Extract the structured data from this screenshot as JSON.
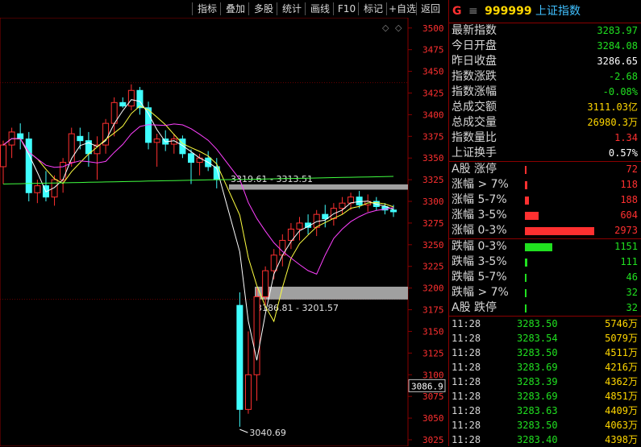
{
  "toolbar": {
    "items": [
      "指标",
      "叠加",
      "多股",
      "统计",
      "画线",
      "F10",
      "标记",
      "+自选",
      "返回"
    ]
  },
  "chart": {
    "price_label": "3086.9",
    "annotations": {
      "upper_zone": "3319.61 - 3313.51",
      "lower_zone": "3186.81 - 3201.57",
      "low_marker": "3040.69"
    },
    "y_ticks": [
      "3500",
      "3475",
      "3450",
      "3425",
      "3400",
      "3375",
      "3350",
      "3325",
      "3300",
      "3275",
      "3250",
      "3225",
      "3200",
      "3175",
      "3150",
      "3125",
      "3100",
      "3075",
      "3050",
      "3025"
    ],
    "colors": {
      "up": "#ff3030",
      "down": "#40ffff",
      "ma1": "#ffffff",
      "ma2": "#ffff40",
      "ma3": "#ff40ff",
      "ma4": "#40ff40",
      "zone": "#a0a0a0"
    }
  },
  "chart_data": {
    "type": "candlestick",
    "ylim": [
      3025,
      3510
    ],
    "candles": [
      {
        "o": 3340,
        "h": 3370,
        "l": 3320,
        "c": 3365
      },
      {
        "o": 3365,
        "h": 3385,
        "l": 3350,
        "c": 3380
      },
      {
        "o": 3378,
        "h": 3390,
        "l": 3360,
        "c": 3372
      },
      {
        "o": 3372,
        "h": 3380,
        "l": 3300,
        "c": 3310
      },
      {
        "o": 3310,
        "h": 3325,
        "l": 3298,
        "c": 3318
      },
      {
        "o": 3318,
        "h": 3335,
        "l": 3300,
        "c": 3305
      },
      {
        "o": 3305,
        "h": 3330,
        "l": 3295,
        "c": 3325
      },
      {
        "o": 3325,
        "h": 3350,
        "l": 3310,
        "c": 3345
      },
      {
        "o": 3345,
        "h": 3385,
        "l": 3340,
        "c": 3378
      },
      {
        "o": 3375,
        "h": 3385,
        "l": 3360,
        "c": 3370
      },
      {
        "o": 3370,
        "h": 3380,
        "l": 3340,
        "c": 3355
      },
      {
        "o": 3355,
        "h": 3375,
        "l": 3325,
        "c": 3365
      },
      {
        "o": 3365,
        "h": 3395,
        "l": 3355,
        "c": 3390
      },
      {
        "o": 3390,
        "h": 3420,
        "l": 3375,
        "c": 3414
      },
      {
        "o": 3414,
        "h": 3420,
        "l": 3408,
        "c": 3410
      },
      {
        "o": 3410,
        "h": 3435,
        "l": 3405,
        "c": 3428
      },
      {
        "o": 3428,
        "h": 3432,
        "l": 3400,
        "c": 3408
      },
      {
        "o": 3408,
        "h": 3415,
        "l": 3360,
        "c": 3368
      },
      {
        "o": 3368,
        "h": 3378,
        "l": 3340,
        "c": 3372
      },
      {
        "o": 3372,
        "h": 3382,
        "l": 3358,
        "c": 3366
      },
      {
        "o": 3366,
        "h": 3378,
        "l": 3355,
        "c": 3372
      },
      {
        "o": 3372,
        "h": 3376,
        "l": 3350,
        "c": 3355
      },
      {
        "o": 3355,
        "h": 3360,
        "l": 3320,
        "c": 3345
      },
      {
        "o": 3345,
        "h": 3355,
        "l": 3330,
        "c": 3350
      },
      {
        "o": 3350,
        "h": 3358,
        "l": 3335,
        "c": 3340
      },
      {
        "o": 3340,
        "h": 3350,
        "l": 3315,
        "c": 3325
      },
      {
        "o": 3180,
        "h": 3195,
        "l": 3040,
        "c": 3060
      },
      {
        "o": 3060,
        "h": 3150,
        "l": 3055,
        "c": 3100
      },
      {
        "o": 3100,
        "h": 3200,
        "l": 3070,
        "c": 3190
      },
      {
        "o": 3190,
        "h": 3225,
        "l": 3180,
        "c": 3220
      },
      {
        "o": 3220,
        "h": 3245,
        "l": 3210,
        "c": 3238
      },
      {
        "o": 3238,
        "h": 3262,
        "l": 3225,
        "c": 3255
      },
      {
        "o": 3255,
        "h": 3275,
        "l": 3245,
        "c": 3268
      },
      {
        "o": 3268,
        "h": 3282,
        "l": 3255,
        "c": 3275
      },
      {
        "o": 3275,
        "h": 3285,
        "l": 3262,
        "c": 3270
      },
      {
        "o": 3270,
        "h": 3290,
        "l": 3260,
        "c": 3285
      },
      {
        "o": 3285,
        "h": 3296,
        "l": 3270,
        "c": 3280
      },
      {
        "o": 3280,
        "h": 3298,
        "l": 3272,
        "c": 3292
      },
      {
        "o": 3292,
        "h": 3305,
        "l": 3285,
        "c": 3298
      },
      {
        "o": 3298,
        "h": 3310,
        "l": 3290,
        "c": 3305
      },
      {
        "o": 3305,
        "h": 3312,
        "l": 3292,
        "c": 3296
      },
      {
        "o": 3296,
        "h": 3308,
        "l": 3288,
        "c": 3300
      },
      {
        "o": 3300,
        "h": 3305,
        "l": 3290,
        "c": 3294
      },
      {
        "o": 3294,
        "h": 3298,
        "l": 3285,
        "c": 3290
      },
      {
        "o": 3290,
        "h": 3296,
        "l": 3282,
        "c": 3288
      }
    ],
    "zones": [
      {
        "label": "3319.61 - 3313.51",
        "low": 3313.51,
        "high": 3319.61
      },
      {
        "label": "3186.81 - 3201.57",
        "low": 3186.81,
        "high": 3201.57
      }
    ]
  },
  "quote": {
    "header": {
      "flag": "G",
      "icon": "menu-icon",
      "code": "999999",
      "name": "上证指数"
    },
    "rows": [
      {
        "label": "最新指数",
        "value": "3283.97",
        "color": "#20e020"
      },
      {
        "label": "今日开盘",
        "value": "3284.08",
        "color": "#20e020"
      },
      {
        "label": "昨日收盘",
        "value": "3286.65",
        "color": "#ffffff"
      },
      {
        "label": "指数涨跌",
        "value": "-2.68",
        "color": "#20e020"
      },
      {
        "label": "指数涨幅",
        "value": "-0.08%",
        "color": "#20e020"
      },
      {
        "label": "总成交额",
        "value": "3111.03亿",
        "color": "#ffd700"
      },
      {
        "label": "总成交量",
        "value": "26980.3万",
        "color": "#ffd700"
      },
      {
        "label": "指数量比",
        "value": "1.34",
        "color": "#ff3030"
      },
      {
        "label": "上证换手",
        "value": "0.57%",
        "color": "#ffffff"
      }
    ],
    "up_stats": [
      {
        "label": "A股 涨停",
        "value": "72",
        "ratio": 0.02
      },
      {
        "label": "涨幅 > 7%",
        "value": "118",
        "ratio": 0.035
      },
      {
        "label": "涨幅 5-7%",
        "value": "188",
        "ratio": 0.06
      },
      {
        "label": "涨幅 3-5%",
        "value": "604",
        "ratio": 0.2
      },
      {
        "label": "涨幅 0-3%",
        "value": "2973",
        "ratio": 1.0
      }
    ],
    "down_stats": [
      {
        "label": "跌幅 0-3%",
        "value": "1151",
        "ratio": 0.39
      },
      {
        "label": "跌幅 3-5%",
        "value": "111",
        "ratio": 0.035
      },
      {
        "label": "跌幅 5-7%",
        "value": "46",
        "ratio": 0.012
      },
      {
        "label": "跌幅 > 7%",
        "value": "32",
        "ratio": 0.008
      },
      {
        "label": "A股 跌停",
        "value": "32",
        "ratio": 0.008
      }
    ],
    "ticks": [
      {
        "time": "11:28",
        "price": "3283.50",
        "vol": "5746万"
      },
      {
        "time": "11:28",
        "price": "3283.54",
        "vol": "5079万"
      },
      {
        "time": "11:28",
        "price": "3283.50",
        "vol": "4511万"
      },
      {
        "time": "11:28",
        "price": "3283.69",
        "vol": "4216万"
      },
      {
        "time": "11:28",
        "price": "3283.39",
        "vol": "4362万"
      },
      {
        "time": "11:28",
        "price": "3283.69",
        "vol": "4851万"
      },
      {
        "time": "11:28",
        "price": "3283.63",
        "vol": "4409万"
      },
      {
        "time": "11:28",
        "price": "3283.50",
        "vol": "4063万"
      },
      {
        "time": "11:28",
        "price": "3283.40",
        "vol": "4398万"
      }
    ]
  }
}
